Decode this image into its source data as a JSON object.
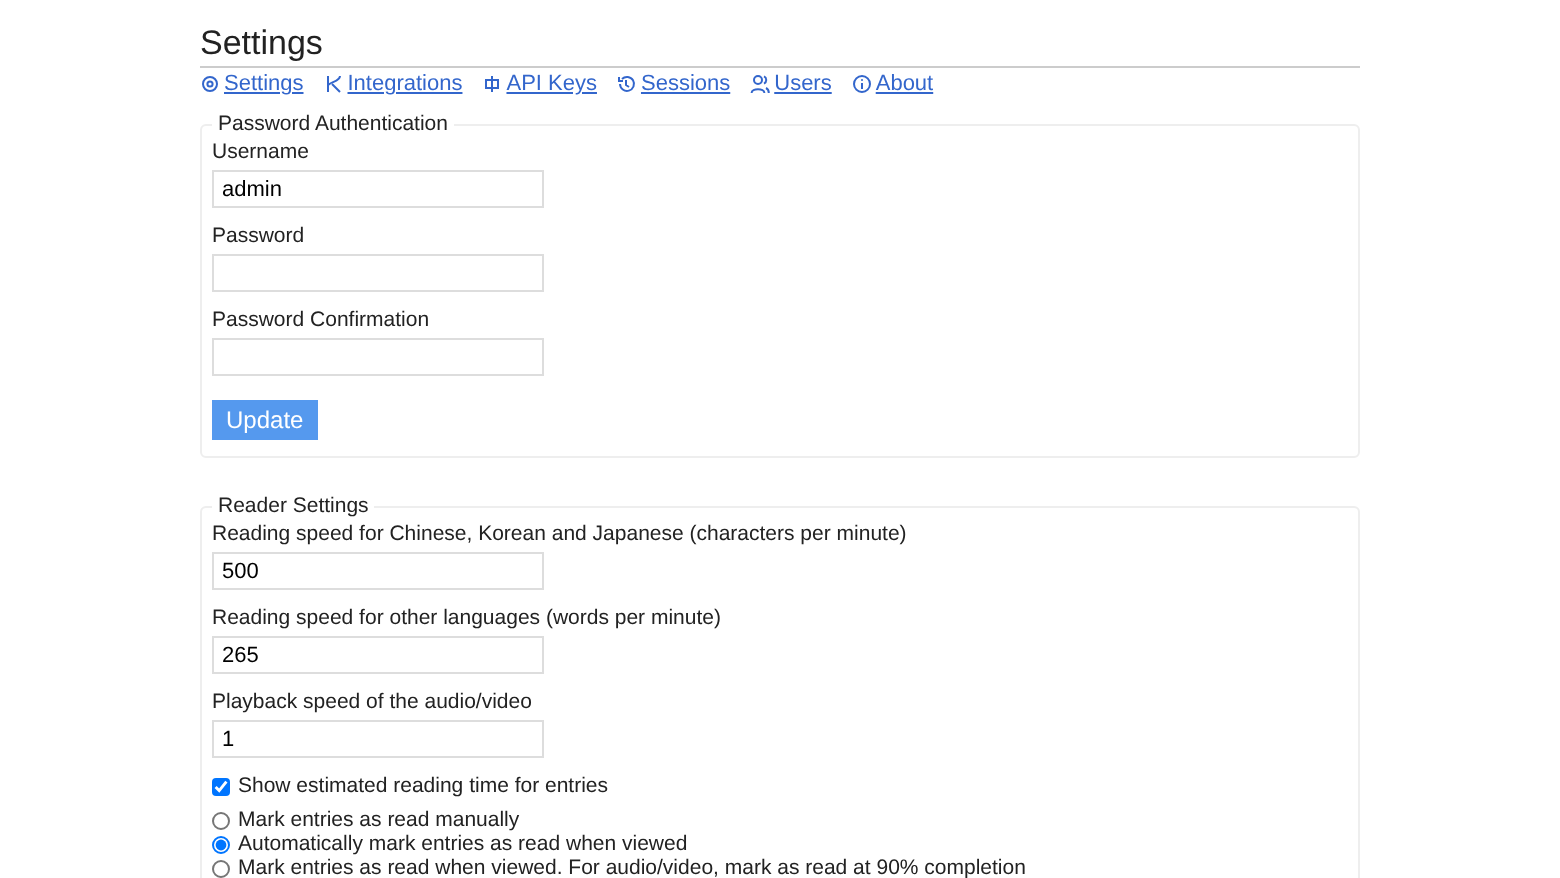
{
  "title": "Settings",
  "nav": [
    {
      "label": "Settings"
    },
    {
      "label": "Integrations"
    },
    {
      "label": "API Keys"
    },
    {
      "label": "Sessions"
    },
    {
      "label": "Users"
    },
    {
      "label": "About"
    }
  ],
  "password_section": {
    "legend": "Password Authentication",
    "fields": [
      {
        "label": "Username",
        "value": "admin"
      },
      {
        "label": "Password"
      },
      {
        "label": "Password Confirmation"
      }
    ],
    "button": "Update"
  },
  "reader_section": {
    "legend": "Reader Settings",
    "fields": [
      {
        "label": "Reading speed for Chinese, Korean and Japanese (characters per minute)",
        "value": "500"
      },
      {
        "label": "Reading speed for other languages (words per minute)",
        "value": "265"
      },
      {
        "label": "Playback speed of the audio/video",
        "value": "1"
      }
    ],
    "checkbox": {
      "label": "Show estimated reading time for entries",
      "checked": true
    },
    "radios": [
      {
        "label": "Mark entries as read manually",
        "selected": false
      },
      {
        "label": "Automatically mark entries as read when viewed",
        "selected": true
      },
      {
        "label": "Mark entries as read when viewed. For audio/video, mark as read at 90% completion",
        "selected": false
      }
    ]
  }
}
